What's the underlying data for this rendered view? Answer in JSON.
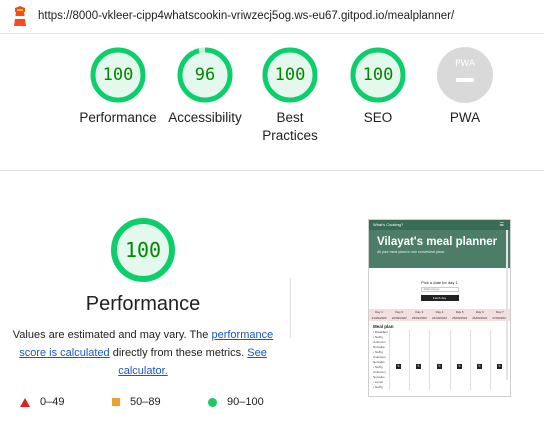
{
  "header": {
    "logo_icon": "lighthouse-icon",
    "url": "https://8000-vkleer-cipp4whatscookin-vriwzecj5og.ws-eu67.gitpod.io/mealplanner/"
  },
  "summary_gauges": [
    {
      "score": "100",
      "label_lines": [
        "Performance"
      ],
      "color": "#0cce6b"
    },
    {
      "score": "96",
      "label_lines": [
        "Accessibility"
      ],
      "color": "#0cce6b"
    },
    {
      "score": "100",
      "label_lines": [
        "Best",
        "Practices"
      ],
      "color": "#0cce6b"
    },
    {
      "score": "100",
      "label_lines": [
        "SEO"
      ],
      "color": "#0cce6b"
    },
    {
      "badge": "PWA",
      "label_lines": [
        "PWA"
      ],
      "color": "#d9d9d9"
    }
  ],
  "performance": {
    "score": "100",
    "title": "Performance",
    "desc_before": "Values are estimated and may vary. The ",
    "link1": "performance score is calculated",
    "desc_middle": " directly from these metrics. ",
    "link2": "See calculator."
  },
  "legend": [
    {
      "symbol": "triangle",
      "range": "0–49",
      "color": "#e02020"
    },
    {
      "symbol": "square",
      "range": "50–89",
      "color": "#f0a030"
    },
    {
      "symbol": "circle",
      "range": "90–100",
      "color": "#18c964"
    }
  ],
  "screenshot": {
    "nav_brand": "What's Cooking?",
    "hero_title": "Vilayat's meal planner",
    "hero_subtitle": "All your meal plans in one convenient place.",
    "pick_text": "Pick a date for day 1",
    "date_placeholder": "dd/mm/yyyy",
    "button": "Fetch day",
    "days": [
      "Day 1",
      "Day 2",
      "Day 3",
      "Day 4",
      "Day 5",
      "Day 6",
      "Day 7"
    ],
    "dates": [
      "21/09/2022",
      "22/09/2022",
      "23/09/2022",
      "24/09/2022",
      "25/09/2022",
      "26/09/2022",
      "27/09/2022"
    ],
    "meal_plan_label": "Meal plan",
    "meal_items": [
      "• Breakfast",
      "• No/fig",
      "  Unknown",
      "  No/value",
      "• No/fig",
      "  Unknown",
      "  No/value",
      "• No/fig",
      "  Unknown",
      "  No/value",
      "• Lunch",
      "• No/fig"
    ]
  }
}
